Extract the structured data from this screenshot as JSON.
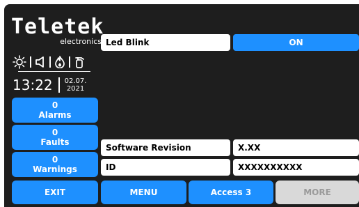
{
  "brand": {
    "name": "Teletek",
    "tagline": "electronics"
  },
  "status_icons": [
    "sun-icon",
    "speaker-icon",
    "fire-icon",
    "fire-extinguisher-icon"
  ],
  "clock": {
    "time": "13:22",
    "date_line1": "02.07.",
    "date_line2": "2021"
  },
  "counters": {
    "alarms": {
      "count": "0",
      "label": "Alarms"
    },
    "faults": {
      "count": "0",
      "label": "Faults"
    },
    "warnings": {
      "count": "0",
      "label": "Warnings"
    }
  },
  "settings": {
    "led_blink": {
      "label": "Led Blink",
      "value": "ON"
    },
    "software_revision": {
      "label": "Software Revision",
      "value": "X.XX"
    },
    "id": {
      "label": "ID",
      "value": "XXXXXXXXXX"
    }
  },
  "buttons": {
    "exit": "EXIT",
    "menu": "MENU",
    "access": "Access 3",
    "more": "MORE"
  },
  "colors": {
    "accent": "#1e90ff",
    "background": "#1e1e1e",
    "disabled": "#d9d9d9"
  }
}
